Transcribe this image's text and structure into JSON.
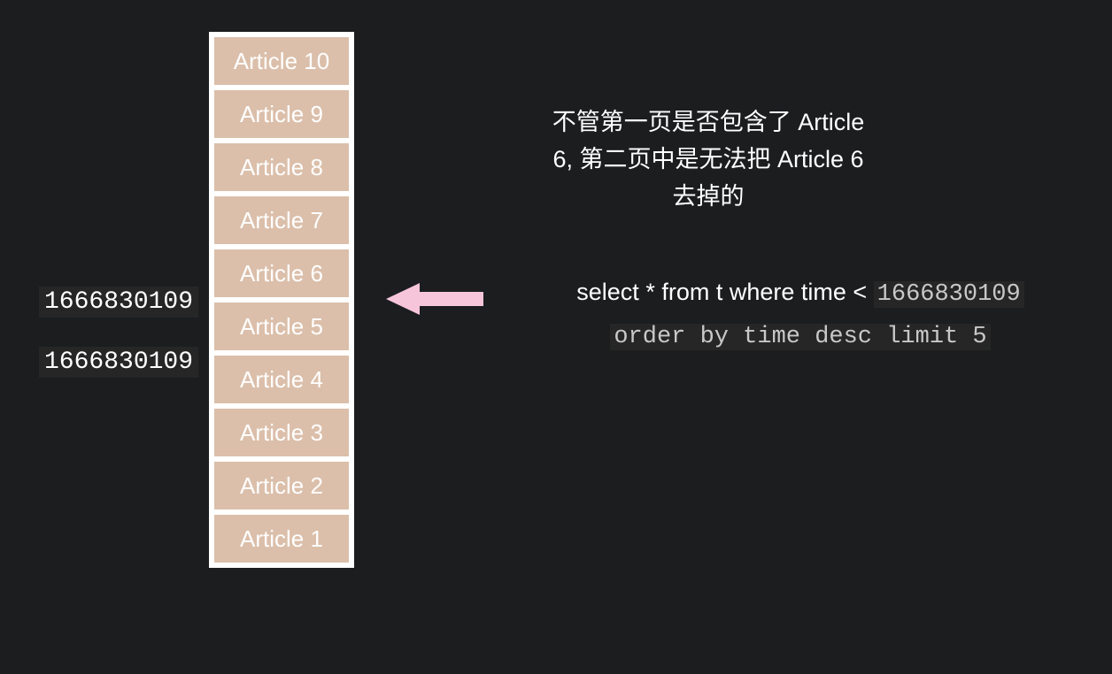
{
  "articles": [
    "Article 10",
    "Article 9",
    "Article 8",
    "Article 7",
    "Article 6",
    "Article 5",
    "Article 4",
    "Article 3",
    "Article 2",
    "Article 1"
  ],
  "timestamps": {
    "ts1": "1666830109",
    "ts2": "1666830109"
  },
  "explanation": {
    "line1": "不管第一页是否包含了 Article",
    "line2": "6, 第二页中是无法把 Article 6",
    "line3": "去掉的"
  },
  "sql": {
    "prefix": "select * from  t where time <",
    "timestamp": "1666830109",
    "suffix": "order by time desc limit 5"
  }
}
